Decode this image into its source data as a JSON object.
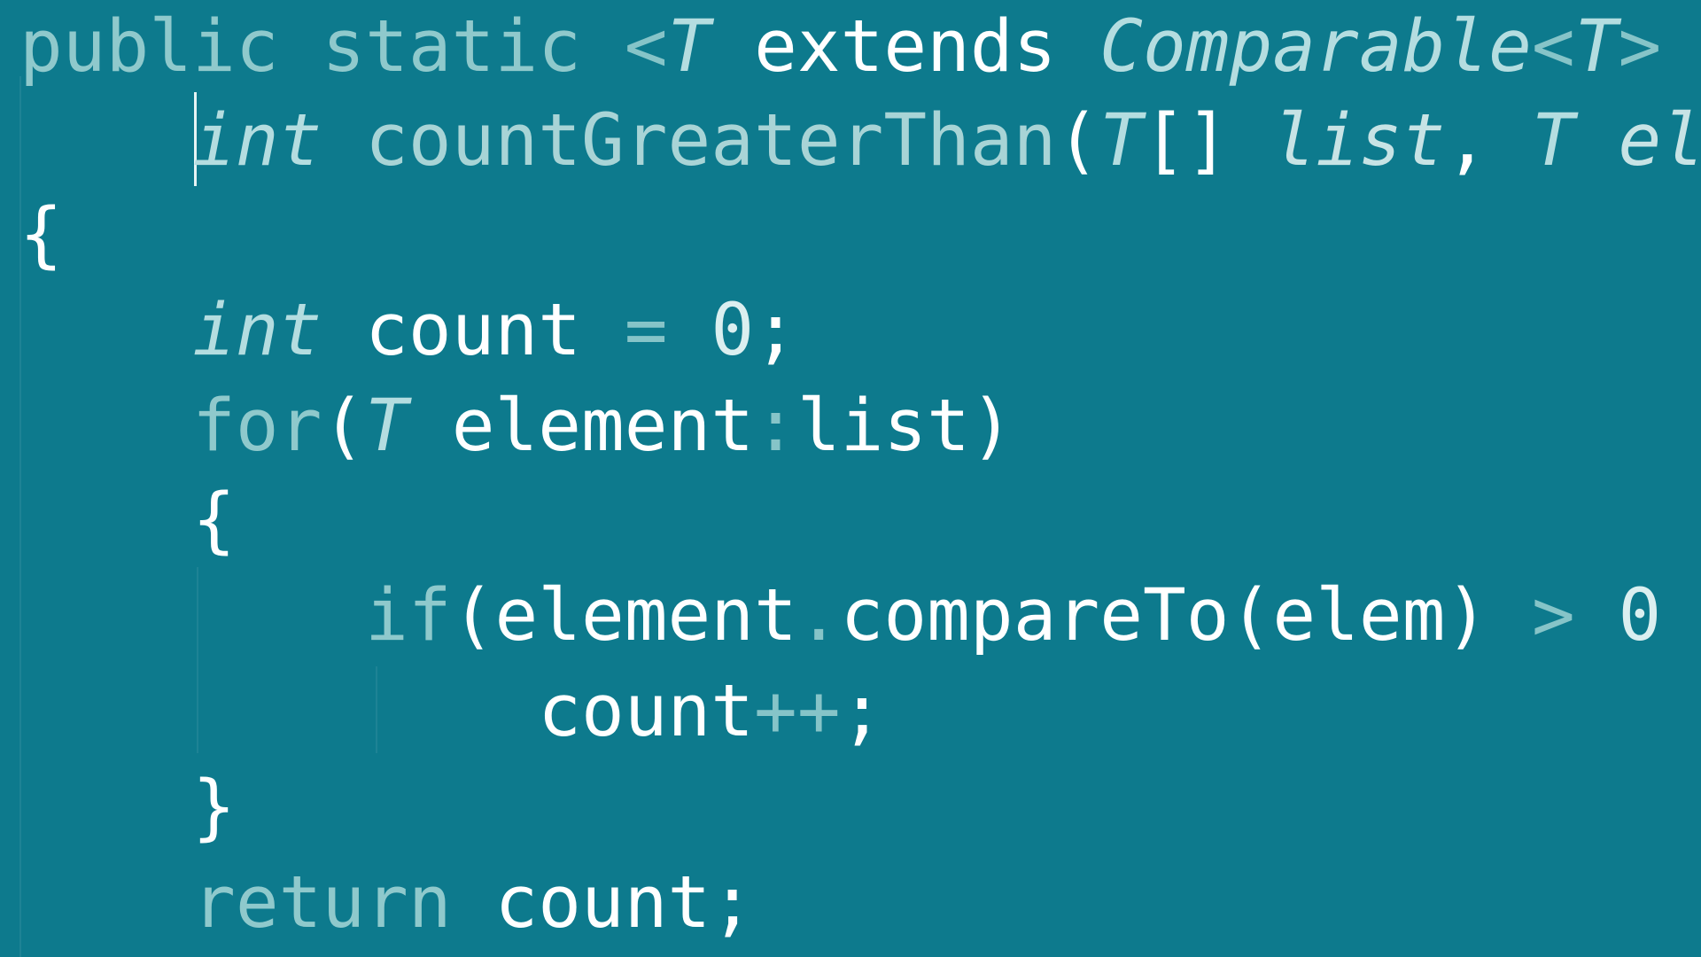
{
  "editor": {
    "background": "#0d7a8d",
    "lines": [
      {
        "tokens": [
          {
            "t": "public ",
            "c": "kw"
          },
          {
            "t": "static ",
            "c": "kw"
          },
          {
            "t": "<",
            "c": "op"
          },
          {
            "t": "T ",
            "c": "ty"
          },
          {
            "t": "extends ",
            "c": "id"
          },
          {
            "t": "Comparable",
            "c": "ty"
          },
          {
            "t": "<",
            "c": "op"
          },
          {
            "t": "T",
            "c": "ty"
          },
          {
            "t": ">",
            "c": "op"
          }
        ]
      },
      {
        "tokens": [
          {
            "t": "    ",
            "c": "pu"
          },
          {
            "t": "int ",
            "c": "ty"
          },
          {
            "t": "countGreaterThan",
            "c": "fn"
          },
          {
            "t": "(",
            "c": "pu"
          },
          {
            "t": "T",
            "c": "ty"
          },
          {
            "t": "[] ",
            "c": "pu"
          },
          {
            "t": "list",
            "c": "pm"
          },
          {
            "t": ", ",
            "c": "pu"
          },
          {
            "t": "T ",
            "c": "ty"
          },
          {
            "t": "elem",
            "c": "pm"
          }
        ]
      },
      {
        "tokens": [
          {
            "t": "{",
            "c": "pu"
          }
        ]
      },
      {
        "tokens": [
          {
            "t": "    ",
            "c": "pu"
          },
          {
            "t": "int ",
            "c": "ty"
          },
          {
            "t": "count ",
            "c": "id"
          },
          {
            "t": "= ",
            "c": "op"
          },
          {
            "t": "0",
            "c": "num"
          },
          {
            "t": ";",
            "c": "pu"
          }
        ]
      },
      {
        "tokens": [
          {
            "t": "    ",
            "c": "pu"
          },
          {
            "t": "for",
            "c": "kw"
          },
          {
            "t": "(",
            "c": "pu"
          },
          {
            "t": "T ",
            "c": "ty"
          },
          {
            "t": "element",
            "c": "id"
          },
          {
            "t": ":",
            "c": "op"
          },
          {
            "t": "list",
            "c": "id"
          },
          {
            "t": ")",
            "c": "pu"
          }
        ]
      },
      {
        "tokens": [
          {
            "t": "    ",
            "c": "pu"
          },
          {
            "t": "{",
            "c": "pu"
          }
        ]
      },
      {
        "tokens": [
          {
            "t": "        ",
            "c": "pu"
          },
          {
            "t": "if",
            "c": "kw"
          },
          {
            "t": "(",
            "c": "pu"
          },
          {
            "t": "element",
            "c": "id"
          },
          {
            "t": ".",
            "c": "op"
          },
          {
            "t": "compareTo",
            "c": "id"
          },
          {
            "t": "(",
            "c": "pu"
          },
          {
            "t": "elem",
            "c": "id"
          },
          {
            "t": ") ",
            "c": "pu"
          },
          {
            "t": "> ",
            "c": "op"
          },
          {
            "t": "0",
            "c": "num"
          }
        ]
      },
      {
        "tokens": [
          {
            "t": "            ",
            "c": "pu"
          },
          {
            "t": "count",
            "c": "id"
          },
          {
            "t": "++",
            "c": "op"
          },
          {
            "t": ";",
            "c": "pu"
          }
        ]
      },
      {
        "tokens": [
          {
            "t": "    ",
            "c": "pu"
          },
          {
            "t": "}",
            "c": "pu"
          }
        ]
      },
      {
        "tokens": [
          {
            "t": "    ",
            "c": "pu"
          },
          {
            "t": "return ",
            "c": "kw"
          },
          {
            "t": "count",
            "c": "id"
          },
          {
            "t": ";",
            "c": "pu"
          }
        ]
      }
    ]
  }
}
